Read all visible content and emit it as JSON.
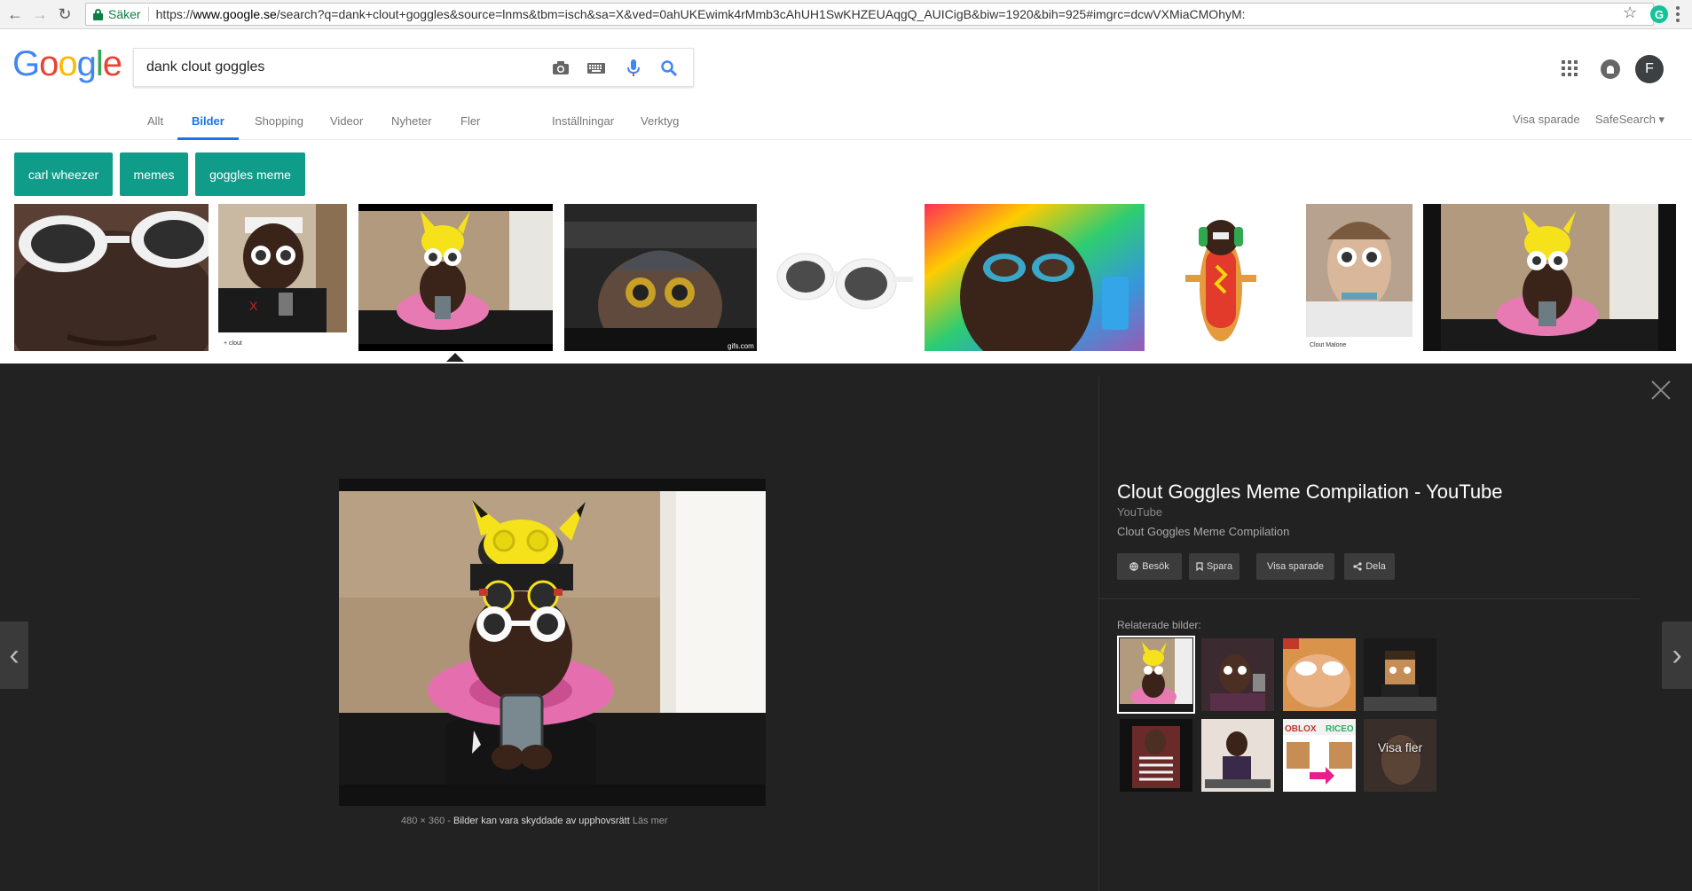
{
  "browser": {
    "secure_label": "Säker",
    "url_prefix": "https://",
    "url_host": "www.google.se",
    "url_rest": "/search?q=dank+clout+goggles&source=lnms&tbm=isch&sa=X&ved=0ahUKEwimk4rMmb3cAhUH1SwKHZEUAqgQ_AUICigB&biw=1920&bih=925#imgrc=dcwVXMiaCMOhyM:"
  },
  "header": {
    "logo": [
      "G",
      "o",
      "o",
      "g",
      "l",
      "e"
    ],
    "search_query": "dank clout goggles",
    "avatar_initial": "F"
  },
  "tabs": {
    "items": [
      "Allt",
      "Bilder",
      "Shopping",
      "Videor",
      "Nyheter",
      "Fler",
      "Inställningar",
      "Verktyg"
    ],
    "active": "Bilder",
    "saved": "Visa sparade",
    "safesearch": "SafeSearch ▾"
  },
  "chips": [
    "carl wheezer",
    "memes",
    "goggles meme"
  ],
  "strip": {
    "captions": [
      "+ clout",
      "gifs.com",
      "Clout Malone"
    ]
  },
  "viewer": {
    "dimensions": "480 × 360",
    "separator": " - ",
    "copyright": "Bilder kan vara skyddade av upphovsrätt",
    "learn_more": "Läs mer",
    "title": "Clout Goggles Meme Compilation - YouTube",
    "source": "YouTube",
    "description": "Clout Goggles Meme Compilation",
    "actions": {
      "visit": "Besök",
      "save": "Spara",
      "view_saved": "Visa sparade",
      "share": "Dela"
    },
    "related_label": "Relaterade bilder:",
    "show_more": "Visa fler"
  },
  "colors": {
    "chip_teal": "#0f9d8a",
    "active_tab_blue": "#1a73e8",
    "viewer_bg": "#222222"
  }
}
